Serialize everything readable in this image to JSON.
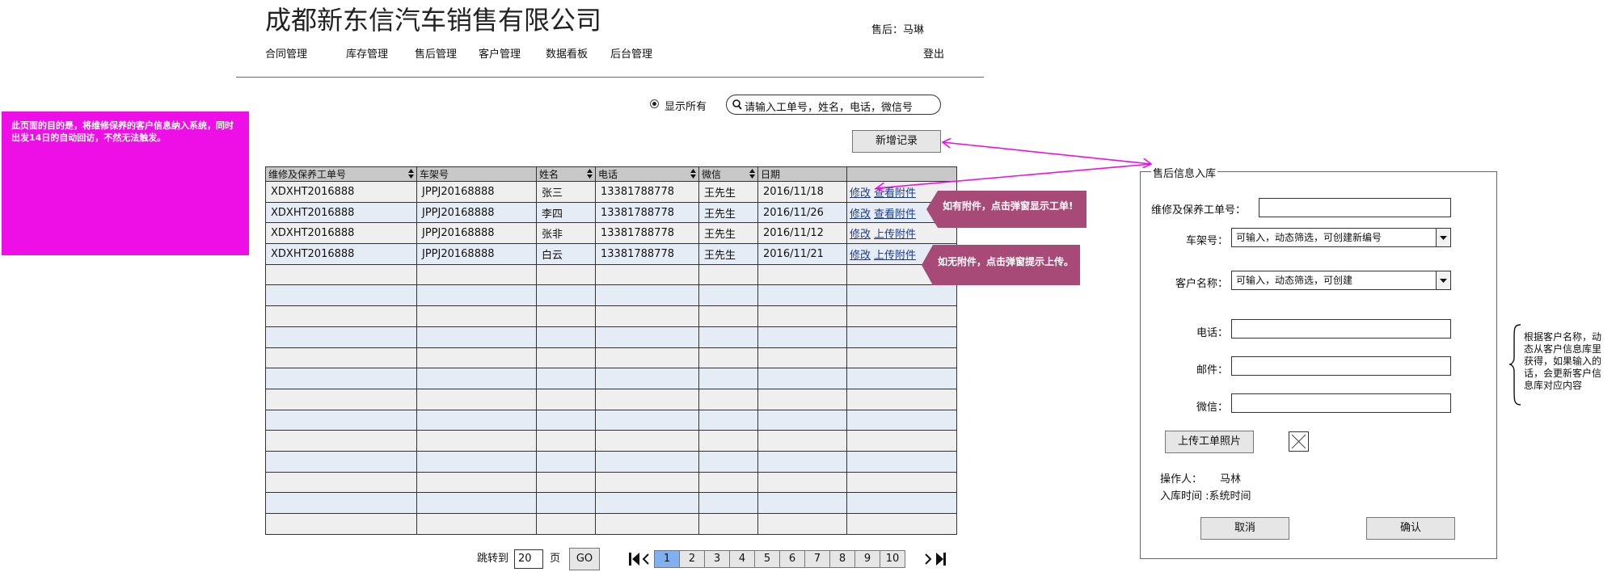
{
  "company_title": "成都新东信汽车销售有限公司",
  "user": {
    "label": "售后：马琳"
  },
  "nav": [
    {
      "label": "合同管理"
    },
    {
      "label": "库存管理"
    },
    {
      "label": "售后管理"
    },
    {
      "label": "客户管理"
    },
    {
      "label": "数据看板"
    },
    {
      "label": "后台管理"
    }
  ],
  "logout": "登出",
  "purpose_note": "此页面的目的是，将维修保养的客户信息纳入系统，同时出发14日的自动回访，不然无法触发。",
  "filter": {
    "show_all": "显示所有",
    "search_placeholder": "请输入工单号，姓名，电话，微信号"
  },
  "add_button": "新增记录",
  "table": {
    "headers": [
      "维修及保养工单号",
      "车架号",
      "姓名",
      "电话",
      "微信",
      "日期",
      ""
    ],
    "rows": [
      {
        "order": "XDXHT2016888",
        "vin": "JPPJ20168888",
        "name": "张三",
        "phone": "13381788778",
        "wechat": "王先生",
        "date": "2016/11/18",
        "edit": "修改",
        "attach": "查看附件"
      },
      {
        "order": "XDXHT2016888",
        "vin": "JPPJ20168888",
        "name": "李四",
        "phone": "13381788778",
        "wechat": "王先生",
        "date": "2016/11/26",
        "edit": "修改",
        "attach": "查看附件"
      },
      {
        "order": "XDXHT2016888",
        "vin": "JPPJ20168888",
        "name": "张非",
        "phone": "13381788778",
        "wechat": "王先生",
        "date": "2016/11/12",
        "edit": "修改",
        "attach": "上传附件"
      },
      {
        "order": "XDXHT2016888",
        "vin": "JPPJ20168888",
        "name": "白云",
        "phone": "13381788778",
        "wechat": "王先生",
        "date": "2016/11/21",
        "edit": "修改",
        "attach": "上传附件"
      }
    ],
    "empty_rows": 13
  },
  "callouts": {
    "with_attachment": "如有附件，点击弹窗显示工单!",
    "without_attachment": "如无附件，点击弹窗提示上传。"
  },
  "pagination": {
    "jump_to": "跳转到",
    "page_value": "20",
    "page_unit": "页",
    "go": "GO",
    "pages": [
      "1",
      "2",
      "3",
      "4",
      "5",
      "6",
      "7",
      "8",
      "9",
      "10"
    ],
    "active_page": "1"
  },
  "form": {
    "legend": "售后信息入库",
    "order_label": "维修及保养工单号：",
    "vin_label": "车架号：",
    "vin_value": "可输入，动态筛选，可创建新编号",
    "customer_label": "客户名称：",
    "customer_value": "可输入，动态筛选，可创建",
    "phone_label": "电话：",
    "email_label": "邮件：",
    "wechat_label": "微信：",
    "upload_button": "上传工单照片",
    "operator_label": "操作人：",
    "operator_value": "马林",
    "entry_time": "入库时间 :系统时间",
    "cancel": "取消",
    "confirm": "确认"
  },
  "side_note": "根据客户名称，动态从客户信息库里获得，如果输入的话，会更新客户信息库对应内容",
  "colors": {
    "note_bg": "#ee0ee6",
    "callout_bg": "#a84a77",
    "arrow": "#ee0ee6",
    "active_page": "#7fb0ef",
    "link": "#1c3d8f"
  }
}
